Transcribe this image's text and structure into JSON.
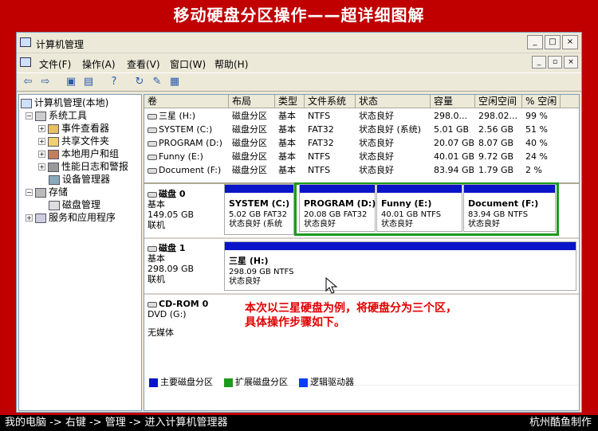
{
  "banner": {
    "title": "移动硬盘分区操作——超详细图解"
  },
  "window": {
    "title": "计算机管理"
  },
  "menubar": {
    "items": [
      "文件(F)",
      "操作(A)",
      "查看(V)",
      "窗口(W)",
      "帮助(H)"
    ]
  },
  "tree": {
    "root": "计算机管理(本地)",
    "system_tools": "系统工具",
    "event_viewer": "事件查看器",
    "shared_folders": "共享文件夹",
    "local_users": "本地用户和组",
    "perf_logs": "性能日志和警报",
    "device_manager": "设备管理器",
    "storage": "存储",
    "disk_management": "磁盘管理",
    "services": "服务和应用程序"
  },
  "volume_table": {
    "headers": [
      "卷",
      "布局",
      "类型",
      "文件系统",
      "状态",
      "容量",
      "空闲空间",
      "% 空闲"
    ],
    "rows": [
      {
        "vol": "三星 (H:)",
        "layout": "磁盘分区",
        "type": "基本",
        "fs": "NTFS",
        "status": "状态良好",
        "cap": "298.0...",
        "free": "298.02...",
        "pct": "99 %"
      },
      {
        "vol": "SYSTEM (C:)",
        "layout": "磁盘分区",
        "type": "基本",
        "fs": "FAT32",
        "status": "状态良好 (系统)",
        "cap": "5.01 GB",
        "free": "2.56 GB",
        "pct": "51 %"
      },
      {
        "vol": "PROGRAM (D:)",
        "layout": "磁盘分区",
        "type": "基本",
        "fs": "FAT32",
        "status": "状态良好",
        "cap": "20.07 GB",
        "free": "8.07 GB",
        "pct": "40 %"
      },
      {
        "vol": "Funny (E:)",
        "layout": "磁盘分区",
        "type": "基本",
        "fs": "NTFS",
        "status": "状态良好",
        "cap": "40.01 GB",
        "free": "9.72 GB",
        "pct": "24 %"
      },
      {
        "vol": "Document (F:)",
        "layout": "磁盘分区",
        "type": "基本",
        "fs": "NTFS",
        "status": "状态良好",
        "cap": "83.94 GB",
        "free": "1.79 GB",
        "pct": "2 %"
      }
    ]
  },
  "disks": {
    "disk0": {
      "name": "磁盘 0",
      "type": "基本",
      "size": "149.05 GB",
      "state": "联机"
    },
    "disk1": {
      "name": "磁盘 1",
      "type": "基本",
      "size": "298.09 GB",
      "state": "联机"
    },
    "cdrom0": {
      "name": "CD-ROM 0",
      "type": "DVD (G:)",
      "state": "无媒体"
    }
  },
  "partitions": {
    "system": {
      "label": "SYSTEM (C:)",
      "size": "5.02 GB FAT32",
      "status": "状态良好 (系统"
    },
    "program": {
      "label": "PROGRAM (D:)",
      "size": "20.08 GB FAT32",
      "status": "状态良好"
    },
    "funny": {
      "label": "Funny (E:)",
      "size": "40.01 GB NTFS",
      "status": "状态良好"
    },
    "document": {
      "label": "Document (F:)",
      "size": "83.94 GB NTFS",
      "status": "状态良好"
    },
    "samsung": {
      "label": "三星 (H:)",
      "size": "298.09 GB NTFS",
      "status": "状态良好"
    }
  },
  "annotation": {
    "line1": "本次以三星硬盘为例，将硬盘分为三个区，",
    "line2": "具体操作步骤如下。"
  },
  "legend": {
    "primary": "主要磁盘分区",
    "extended": "扩展磁盘分区",
    "logical": "逻辑驱动器"
  },
  "colors": {
    "primary": "#0a14c8",
    "extended": "#1d9a1d",
    "logical": "#0a3cff",
    "banner": "#c00000"
  },
  "footer": {
    "path": "我的电脑 -> 右键 -> 管理 -> 进入计算机管理器",
    "credit": "杭州酷鱼制作"
  }
}
